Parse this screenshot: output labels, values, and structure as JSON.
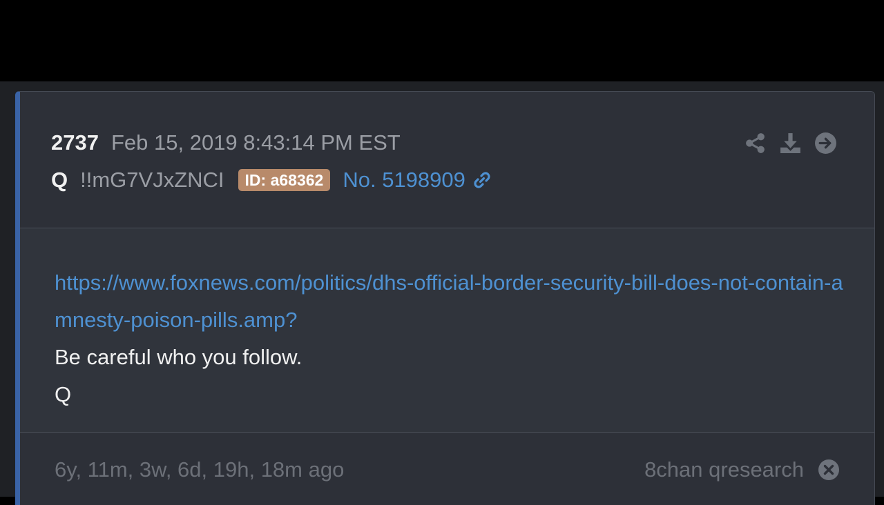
{
  "post": {
    "number": "2737",
    "timestamp": "Feb 15, 2019 8:43:14 PM EST",
    "author": "Q",
    "tripcode": "!!mG7VJxZNCI",
    "id_badge": "ID: a68362",
    "post_no": "No. 5198909",
    "icons": [
      "share-icon",
      "download-icon",
      "arrow-right-circle-icon",
      "link-chain-icon",
      "close-circle-icon"
    ]
  },
  "body": {
    "link": "https://www.foxnews.com/politics/dhs-official-border-security-bill-does-not-contain-amnesty-poison-pills.amp?",
    "line1": "Be careful who you follow.",
    "line2": "Q"
  },
  "footer": {
    "age": "6y, 11m, 3w, 6d, 19h, 18m ago",
    "source": "8chan qresearch"
  },
  "colors": {
    "accent_border": "#3a63a6",
    "link": "#4e91d2",
    "badge": "#b88a6a",
    "card_bg": "#2d3038"
  }
}
